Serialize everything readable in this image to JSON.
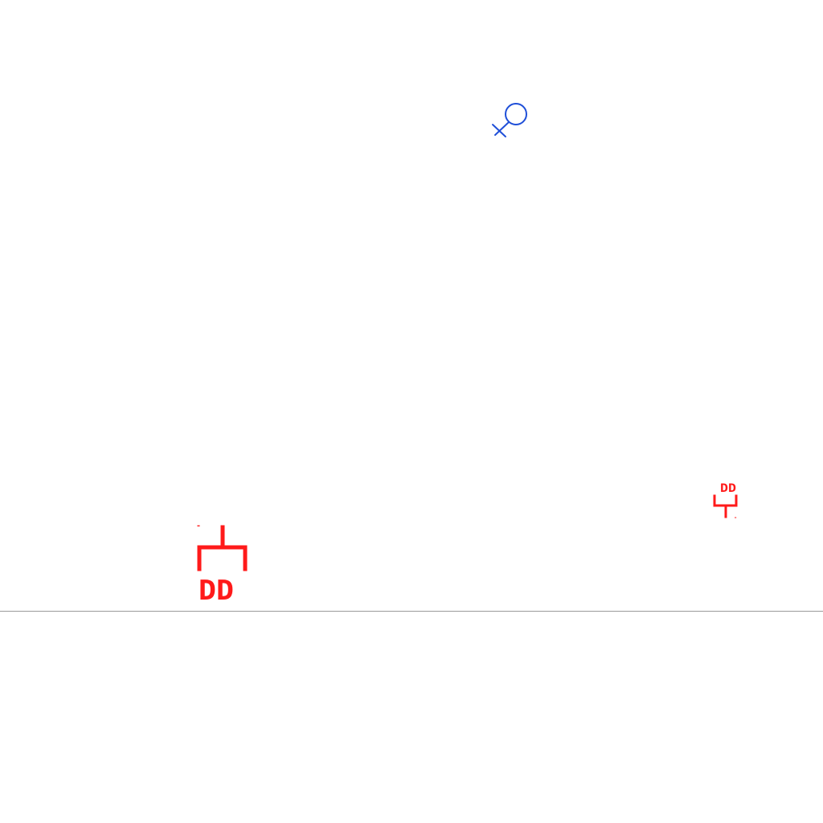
{
  "canvas": {
    "background": "#ffffff"
  },
  "colors": {
    "blue_symbol": "#1f4fd8",
    "red_symbol": "#ff1a1a",
    "baseline": "#9a9a9a"
  },
  "symbols": [
    {
      "name": "female-symbol-icon",
      "color": "blue_symbol"
    },
    {
      "name": "branch-large-icon",
      "color": "red_symbol"
    },
    {
      "name": "branch-small-icon",
      "color": "red_symbol"
    }
  ],
  "labels": {
    "large_branch_text": "DD",
    "small_branch_text": "DD",
    "large_branch_tick": "-",
    "small_branch_tick": "-"
  }
}
